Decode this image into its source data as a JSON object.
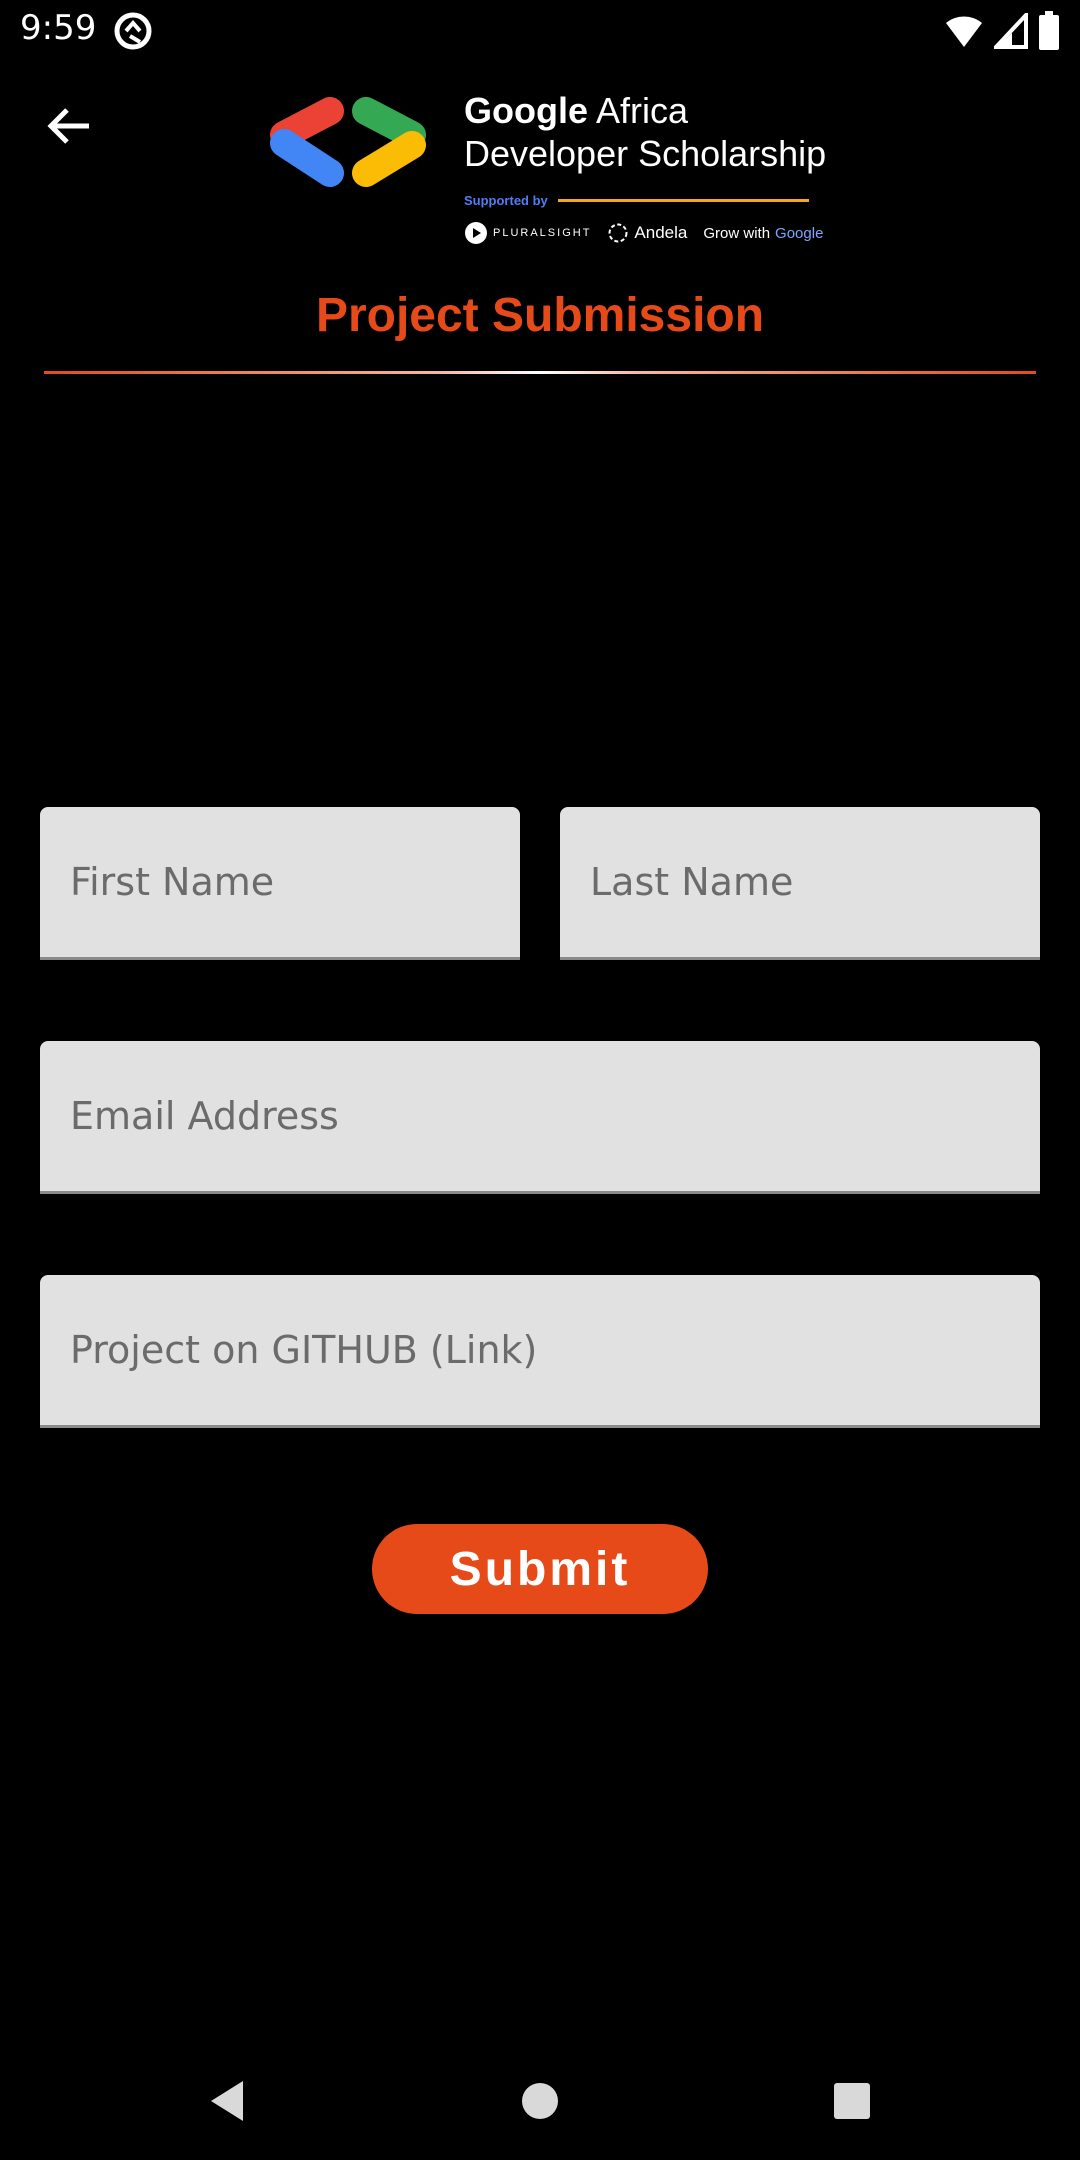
{
  "status_bar": {
    "time": "9:59",
    "icons": [
      "notification-icon",
      "wifi-icon",
      "signal-icon",
      "battery-icon"
    ]
  },
  "header": {
    "back_icon": "arrow-back-icon",
    "brand_line1_bold": "Google",
    "brand_line1_rest": " Africa",
    "brand_line2": "Developer Scholarship",
    "supported_by": "Supported by",
    "partners": {
      "pluralsight": "PLURALSIGHT",
      "andela": "Andela",
      "grow_with": "Grow with ",
      "google": "Google"
    }
  },
  "page": {
    "title": "Project Submission"
  },
  "form": {
    "first_name_placeholder": "First Name",
    "last_name_placeholder": "Last Name",
    "email_placeholder": "Email Address",
    "github_placeholder": "Project on GITHUB (Link)",
    "submit_label": "Submit"
  },
  "colors": {
    "accent": "#e64a19",
    "background": "#000000",
    "field_background": "#e1e1e1",
    "supported_by_blue": "#4f7df5",
    "supported_by_line": "#f5a623"
  },
  "nav_bar": {
    "icons": [
      "back-triangle-icon",
      "home-circle-icon",
      "recents-square-icon"
    ]
  }
}
